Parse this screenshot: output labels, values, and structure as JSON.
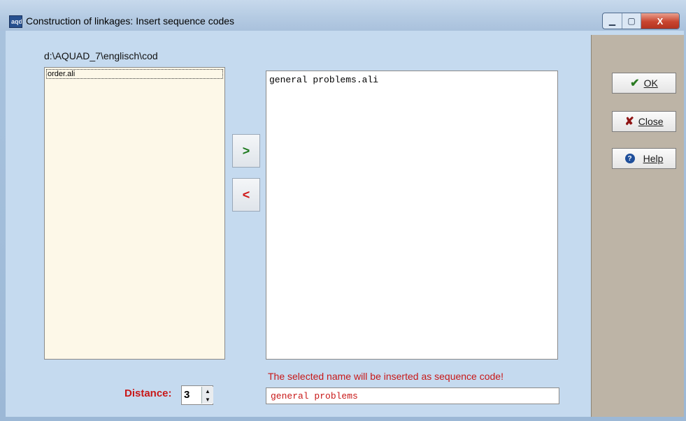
{
  "window": {
    "title": "Construction of linkages: Insert sequence codes",
    "app_icon_text": "aqd",
    "caption": {
      "minimize": "▁",
      "maximize": "▢",
      "close": "X"
    }
  },
  "left_panel": {
    "path": "d:\\AQUAD_7\\englisch\\cod",
    "items": [
      "order.ali"
    ]
  },
  "transfer": {
    "add_label": ">",
    "remove_label": "<"
  },
  "right_panel": {
    "items": [
      "general problems.ali"
    ]
  },
  "info": {
    "message": "The selected name will be inserted as sequence code!"
  },
  "code_field": {
    "value": "general problems"
  },
  "distance": {
    "label": "Distance:",
    "value": "3"
  },
  "buttons": {
    "ok": {
      "label": "OK",
      "icon": "checkmark-icon"
    },
    "close": {
      "label": "Close",
      "icon": "x-icon"
    },
    "help": {
      "label": "Help",
      "icon": "help-icon"
    }
  },
  "colors": {
    "accent_red": "#c81818",
    "ok_green": "#2a7a21",
    "panel_tan": "#bdb4a6"
  }
}
